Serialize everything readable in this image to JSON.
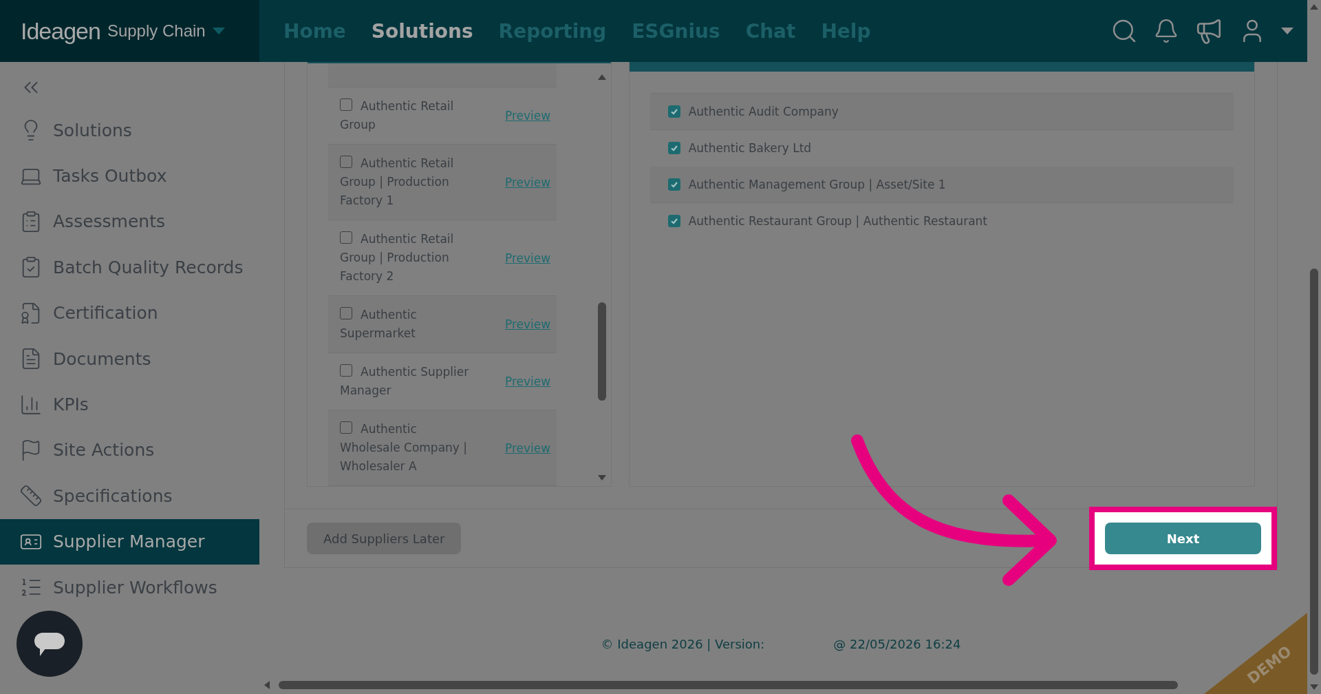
{
  "header": {
    "logo": "Ideagen",
    "product": "Supply Chain",
    "nav": [
      {
        "label": "Home",
        "selected": false
      },
      {
        "label": "Solutions",
        "selected": true
      },
      {
        "label": "Reporting",
        "selected": false
      },
      {
        "label": "ESGnius",
        "selected": false
      },
      {
        "label": "Chat",
        "selected": false
      },
      {
        "label": "Help",
        "selected": false
      }
    ]
  },
  "sidebar": {
    "items": [
      {
        "label": "Solutions",
        "selected": false
      },
      {
        "label": "Tasks Outbox",
        "selected": false
      },
      {
        "label": "Assessments",
        "selected": false
      },
      {
        "label": "Batch Quality Records",
        "selected": false
      },
      {
        "label": "Certification",
        "selected": false
      },
      {
        "label": "Documents",
        "selected": false
      },
      {
        "label": "KPIs",
        "selected": false
      },
      {
        "label": "Site Actions",
        "selected": false
      },
      {
        "label": "Specifications",
        "selected": false
      },
      {
        "label": "Supplier Manager",
        "selected": true
      },
      {
        "label": "Supplier Workflows",
        "selected": false
      }
    ]
  },
  "available_suppliers": [
    {
      "name": "Authentic Retail Group",
      "link": "Preview",
      "checked": false
    },
    {
      "name": "Authentic Retail Group | Production Factory 1",
      "link": "Preview",
      "checked": false
    },
    {
      "name": "Authentic Retail Group | Production Factory 2",
      "link": "Preview",
      "checked": false
    },
    {
      "name": "Authentic Supermarket",
      "link": "Preview",
      "checked": false
    },
    {
      "name": "Authentic Supplier Manager",
      "link": "Preview",
      "checked": false
    },
    {
      "name": "Authentic Wholesale Company | Wholesaler A",
      "link": "Preview",
      "checked": false
    }
  ],
  "selected_suppliers": [
    {
      "name": "Authentic Audit Company",
      "checked": true
    },
    {
      "name": "Authentic Bakery Ltd",
      "checked": true
    },
    {
      "name": "Authentic Management Group | Asset/Site 1",
      "checked": true
    },
    {
      "name": "Authentic Restaurant Group | Authentic Restaurant",
      "checked": true
    }
  ],
  "buttons": {
    "later": "Add Suppliers Later",
    "next": "Next"
  },
  "footer": {
    "copyright": "© Ideagen 2026 | Version:",
    "timestamp": "@ 22/05/2026 16:24"
  },
  "corner_ribbon": "DEMO"
}
